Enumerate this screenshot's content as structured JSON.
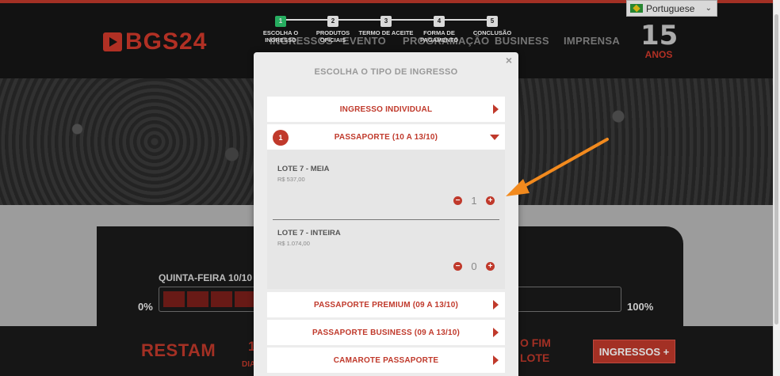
{
  "site": {
    "logo_text": "BGS24",
    "nav": [
      "INGRESSOS",
      "EVENTO",
      "PROGRAMAÇÃO",
      "BUSINESS",
      "IMPRENSA"
    ],
    "anniversary": {
      "number": "15",
      "label": "ANOS"
    },
    "language": {
      "selected": "Portuguese",
      "flag": "brazil-flag-icon"
    },
    "accent_color": "#c0392b"
  },
  "stepper": {
    "steps": [
      {
        "num": "1",
        "label": "ESCOLHA O INGRESSO",
        "active": true
      },
      {
        "num": "2",
        "label": "PRODUTOS OFICIAIS",
        "active": false
      },
      {
        "num": "3",
        "label": "TERMO DE ACEITE",
        "active": false
      },
      {
        "num": "4",
        "label": "FORMA DE PAGAMENTO",
        "active": false
      },
      {
        "num": "5",
        "label": "CONCLUSÃO",
        "active": false
      }
    ]
  },
  "background": {
    "day_label": "QUINTA-FEIRA 10/10",
    "pct_left": "0%",
    "pct_right": "100%",
    "restam": "RESTAM",
    "footer_number": "1",
    "footer_small": "DIA",
    "fim_line1": "O FIM",
    "fim_line2": "LOTE",
    "ingressos_button": "INGRESSOS +"
  },
  "modal": {
    "close": "×",
    "title": "ESCOLHA O TIPO DE INGRESSO",
    "options": [
      {
        "label": "INGRESSO INDIVIDUAL"
      },
      {
        "label": "PASSAPORTE (10 A 13/10)",
        "badge": "1",
        "expanded": true
      },
      {
        "label": "PASSAPORTE PREMIUM (09 A 13/10)"
      },
      {
        "label": "PASSAPORTE BUSINESS (09 A 13/10)"
      },
      {
        "label": "CAMAROTE PASSAPORTE"
      }
    ],
    "lotes": [
      {
        "name": "LOTE 7 - MEIA",
        "price": "R$ 537,00",
        "qty": "1"
      },
      {
        "name": "LOTE 7 - INTEIRA",
        "price": "R$ 1.074,00",
        "qty": "0"
      }
    ],
    "minus": "−",
    "plus": "+"
  }
}
